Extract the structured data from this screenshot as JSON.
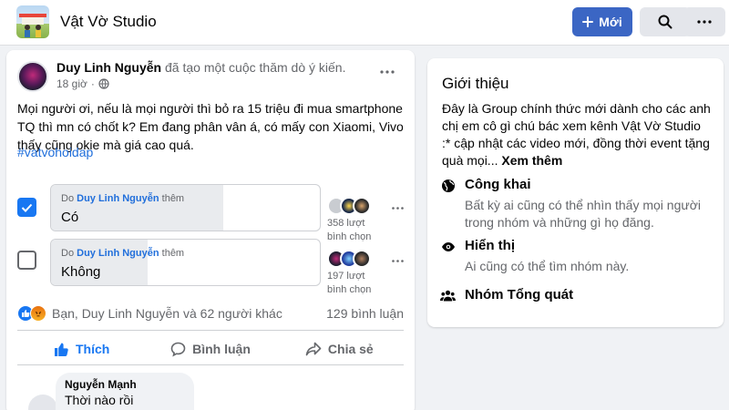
{
  "header": {
    "group_name": "Vật Vờ Studio",
    "new_button_label": "Mới",
    "search_icon": "search-icon",
    "more_icon": "more-horizontal-icon"
  },
  "post": {
    "author": "Duy Linh Nguyễn",
    "action": "đã tạo một cuộc thăm dò ý kiến.",
    "time": "18 giờ",
    "privacy_icon": "globe-icon",
    "text": "Mọi người ơi, nếu là mọi người thì bỏ ra 15 triệu đi mua smartphone TQ thì mn có chốt k? Em đang phân vân á, có mấy con Xiaomi, Vivo thấy cũng okie mà giá cao quá.",
    "hashtag": "#vatvohoidap",
    "poll": [
      {
        "checked": true,
        "added_by_prefix": "Do",
        "added_by": "Duy Linh Nguyễn",
        "added_by_suffix": "thêm",
        "label": "Có",
        "votes_line1": "358 lượt",
        "votes_line2": "bình chọn",
        "fill_fraction": 0.64
      },
      {
        "checked": false,
        "added_by_prefix": "Do",
        "added_by": "Duy Linh Nguyễn",
        "added_by_suffix": "thêm",
        "label": "Không",
        "votes_line1": "197 lượt",
        "votes_line2": "bình chọn",
        "fill_fraction": 0.36
      }
    ],
    "reactions_text": "Bạn, Duy Linh Nguyễn và 62 người khác",
    "comment_count": "129 bình luận",
    "actions": {
      "like": "Thích",
      "comment": "Bình luận",
      "share": "Chia sẻ"
    },
    "comment": {
      "author": "Nguyễn Mạnh",
      "text": "Thời nào rồi"
    }
  },
  "about": {
    "title": "Giới thiệu",
    "description": "Đây là Group chính thức mới dành cho các anh chị em cô gì chú bác xem kênh Vật Vờ Studio :* cập nhật các video mới, đồng thời event tặng quà mọi...",
    "see_more": "Xem thêm",
    "items": [
      {
        "icon": "globe-icon",
        "title": "Công khai",
        "desc": "Bất kỳ ai cũng có thể nhìn thấy mọi người trong nhóm và những gì họ đăng."
      },
      {
        "icon": "eye-icon",
        "title": "Hiển thị",
        "desc": "Ai cũng có thể tìm nhóm này."
      },
      {
        "icon": "people-icon",
        "title": "Nhóm Tổng quát",
        "desc": ""
      }
    ]
  },
  "colors": {
    "primary": "#1877f2",
    "new_button": "#3b66c4",
    "link": "#216fdb",
    "secondary_text": "#65676b"
  }
}
